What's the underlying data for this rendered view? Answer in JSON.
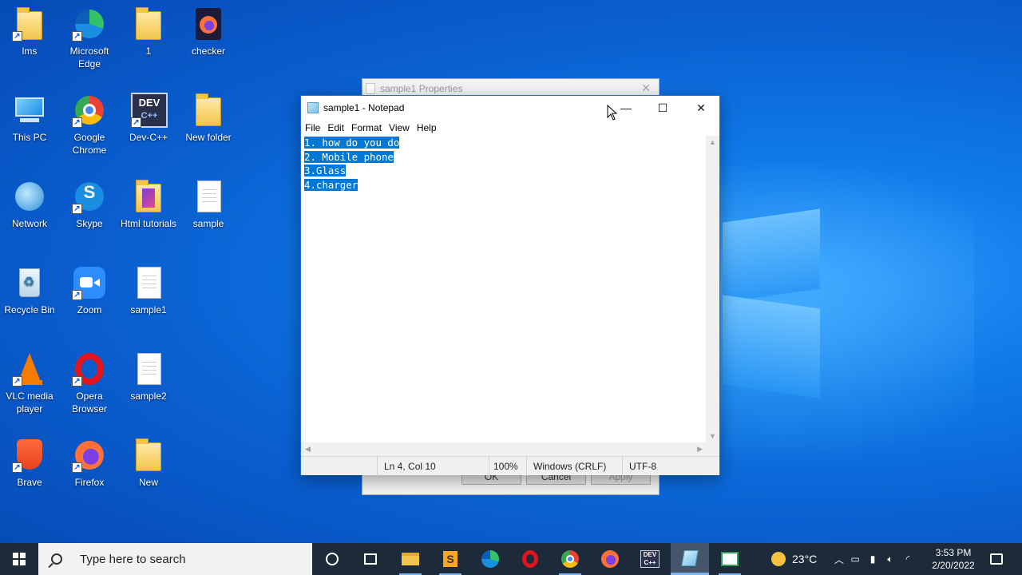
{
  "desktop": {
    "icons": [
      {
        "label": "lms"
      },
      {
        "label": "Microsoft Edge"
      },
      {
        "label": "1"
      },
      {
        "label": "checker"
      },
      {
        "label": "This PC"
      },
      {
        "label": "Google Chrome"
      },
      {
        "label": "Dev-C++"
      },
      {
        "label": "New folder"
      },
      {
        "label": "Network"
      },
      {
        "label": "Skype"
      },
      {
        "label": "Html tutorials"
      },
      {
        "label": "sample"
      },
      {
        "label": "Recycle Bin"
      },
      {
        "label": "Zoom"
      },
      {
        "label": "sample1"
      },
      {
        "label": "VLC media player"
      },
      {
        "label": "Opera Browser"
      },
      {
        "label": "sample2"
      },
      {
        "label": "Brave"
      },
      {
        "label": "Firefox"
      },
      {
        "label": "New"
      }
    ]
  },
  "properties_window": {
    "title": "sample1 Properties",
    "ok_label": "OK",
    "cancel_label": "Cancel",
    "apply_label": "Apply"
  },
  "notepad": {
    "title": "sample1 - Notepad",
    "menu": [
      "File",
      "Edit",
      "Format",
      "View",
      "Help"
    ],
    "lines": [
      "1. how do you do",
      "2. Mobile phone",
      "3.Glass",
      "4.charger"
    ],
    "status": {
      "position": "Ln 4, Col 10",
      "zoom": "100%",
      "line_ending": "Windows (CRLF)",
      "encoding": "UTF-8"
    }
  },
  "taskbar": {
    "search_placeholder": "Type here to search",
    "weather": "23°C",
    "time": "3:53 PM",
    "date": "2/20/2022"
  },
  "colors": {
    "selection": "#0078d7",
    "taskbar": "#1d2a3a",
    "desktop": "#0a5fd0"
  }
}
